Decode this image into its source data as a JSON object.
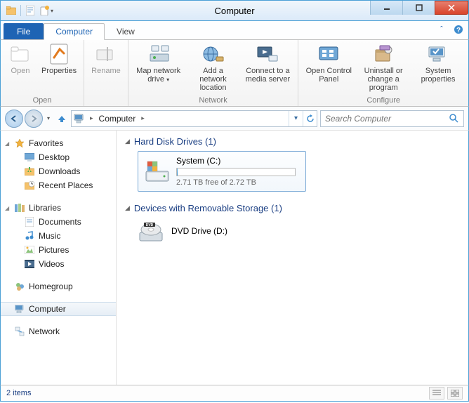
{
  "window": {
    "title": "Computer"
  },
  "tabs": {
    "file": "File",
    "computer": "Computer",
    "view": "View"
  },
  "ribbon": {
    "open": "Open",
    "properties": "Properties",
    "rename": "Rename",
    "map_network_drive": "Map network drive",
    "add_network_location": "Add a network location",
    "connect_media": "Connect to a media server",
    "open_control_panel": "Open Control Panel",
    "uninstall": "Uninstall or change a program",
    "system_properties": "System properties",
    "group_open": "Open",
    "group_network": "Network",
    "group_configure": "Configure"
  },
  "address": {
    "root": "Computer",
    "search_placeholder": "Search Computer"
  },
  "sidebar": {
    "favorites": "Favorites",
    "desktop": "Desktop",
    "downloads": "Downloads",
    "recent": "Recent Places",
    "libraries": "Libraries",
    "documents": "Documents",
    "music": "Music",
    "pictures": "Pictures",
    "videos": "Videos",
    "homegroup": "Homegroup",
    "computer": "Computer",
    "network": "Network"
  },
  "categories": {
    "hdd": "Hard Disk Drives (1)",
    "removable": "Devices with Removable Storage (1)"
  },
  "drives": {
    "system": {
      "name": "System (C:)",
      "space": "2.71 TB free of 2.72 TB"
    },
    "dvd": {
      "name": "DVD Drive (D:)"
    }
  },
  "status": {
    "items": "2 items"
  }
}
